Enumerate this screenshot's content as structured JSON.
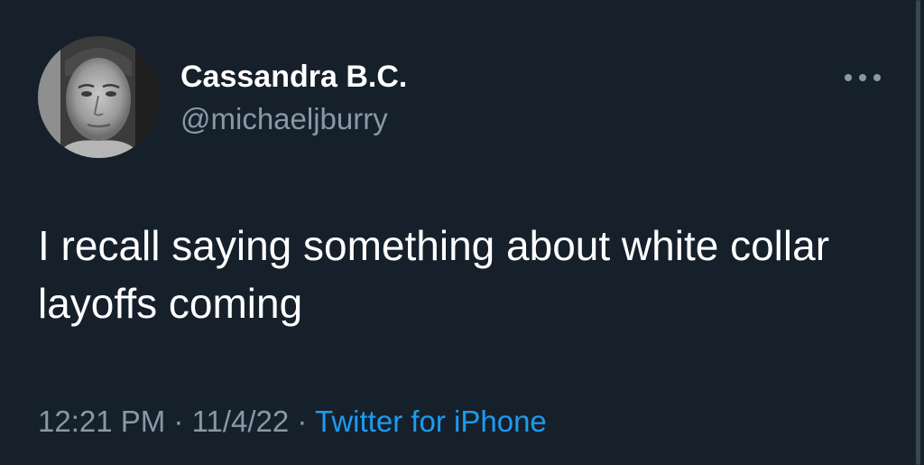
{
  "tweet": {
    "display_name": "Cassandra B.C.",
    "handle": "@michaeljburry",
    "text": "I recall saying something about white collar layoffs coming",
    "time": "12:21 PM",
    "separator": "·",
    "date": "11/4/22",
    "source": "Twitter for iPhone"
  },
  "icons": {
    "avatar": "profile-photo-icon",
    "more": "more-horizontal-icon"
  },
  "colors": {
    "background": "#15202b",
    "text_primary": "#ffffff",
    "text_secondary": "#8899a6",
    "link": "#1d9bf0"
  }
}
